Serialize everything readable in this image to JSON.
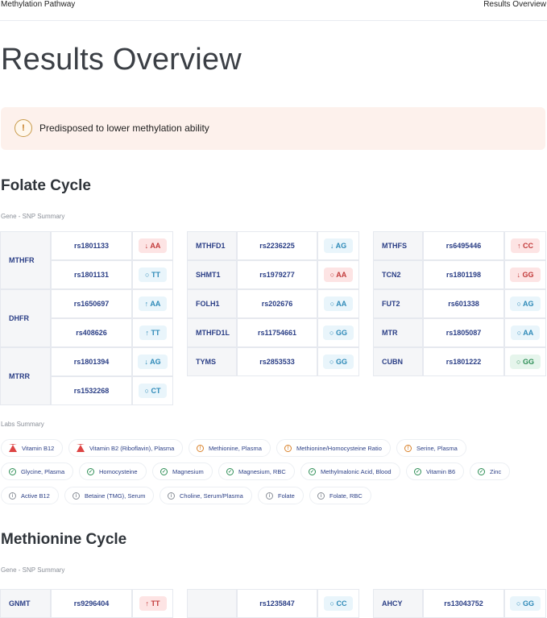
{
  "header": {
    "left": "Methylation Pathway",
    "right": "Results Overview"
  },
  "page_title": "Results Overview",
  "alert": {
    "icon": "exclamation-icon",
    "text": "Predisposed to lower methylation ability"
  },
  "folate": {
    "title": "Folate Cycle",
    "snp_label": "Gene - SNP Summary",
    "col1": {
      "rows": [
        {
          "gene": "MTHFR",
          "rs": "rs1801133",
          "gt": "↓ AA",
          "kind": "red"
        },
        {
          "gene": "",
          "rs": "rs1801131",
          "gt": "○ TT",
          "kind": "blue"
        },
        {
          "gene": "DHFR",
          "rs": "rs1650697",
          "gt": "↑ AA",
          "kind": "blue"
        },
        {
          "gene": "",
          "rs": "rs408626",
          "gt": "↑ TT",
          "kind": "blue"
        },
        {
          "gene": "MTRR",
          "rs": "rs1801394",
          "gt": "↓ AG",
          "kind": "blue"
        },
        {
          "gene": "",
          "rs": "rs1532268",
          "gt": "○ CT",
          "kind": "blue"
        }
      ]
    },
    "col2": {
      "rows": [
        {
          "gene": "MTHFD1",
          "rs": "rs2236225",
          "gt": "↓ AG",
          "kind": "blue"
        },
        {
          "gene": "SHMT1",
          "rs": "rs1979277",
          "gt": "○ AA",
          "kind": "red"
        },
        {
          "gene": "FOLH1",
          "rs": "rs202676",
          "gt": "○ AA",
          "kind": "blue"
        },
        {
          "gene": "MTHFD1L",
          "rs": "rs11754661",
          "gt": "○ GG",
          "kind": "blue"
        },
        {
          "gene": "TYMS",
          "rs": "rs2853533",
          "gt": "○ GG",
          "kind": "blue"
        }
      ]
    },
    "col3": {
      "rows": [
        {
          "gene": "MTHFS",
          "rs": "rs6495446",
          "gt": "↑ CC",
          "kind": "red"
        },
        {
          "gene": "TCN2",
          "rs": "rs1801198",
          "gt": "↓ GG",
          "kind": "red"
        },
        {
          "gene": "FUT2",
          "rs": "rs601338",
          "gt": "○ AG",
          "kind": "blue"
        },
        {
          "gene": "MTR",
          "rs": "rs1805087",
          "gt": "○ AA",
          "kind": "blue"
        },
        {
          "gene": "CUBN",
          "rs": "rs1801222",
          "gt": "○ GG",
          "kind": "green"
        }
      ]
    },
    "labs_label": "Labs Summary",
    "labs": [
      [
        {
          "label": "Vitamin B12",
          "icon": "warning-icon",
          "kind": "warn"
        },
        {
          "label": "Vitamin B2 (Riboflavin), Plasma",
          "icon": "warning-icon",
          "kind": "warn"
        },
        {
          "label": "Methionine, Plasma",
          "icon": "info-icon",
          "kind": "orange"
        },
        {
          "label": "Methionine/Homocysteine Ratio",
          "icon": "info-icon",
          "kind": "orange"
        },
        {
          "label": "Serine, Plasma",
          "icon": "info-icon",
          "kind": "orange"
        }
      ],
      [
        {
          "label": "Glycine, Plasma",
          "icon": "check-icon",
          "kind": "green"
        },
        {
          "label": "Homocysteine",
          "icon": "check-icon",
          "kind": "green"
        },
        {
          "label": "Magnesium",
          "icon": "check-icon",
          "kind": "green"
        },
        {
          "label": "Magnesium, RBC",
          "icon": "check-icon",
          "kind": "green"
        },
        {
          "label": "Methylmalonic Acid, Blood",
          "icon": "check-icon",
          "kind": "green"
        },
        {
          "label": "Vitamin B6",
          "icon": "check-icon",
          "kind": "green"
        },
        {
          "label": "Zinc",
          "icon": "check-icon",
          "kind": "green"
        }
      ],
      [
        {
          "label": "Active B12",
          "icon": "info-icon",
          "kind": "grey"
        },
        {
          "label": "Betaine (TMG), Serum",
          "icon": "info-icon",
          "kind": "grey"
        },
        {
          "label": "Choline, Serum/Plasma",
          "icon": "info-icon",
          "kind": "grey"
        },
        {
          "label": "Folate",
          "icon": "info-icon",
          "kind": "grey"
        },
        {
          "label": "Folate, RBC",
          "icon": "info-icon",
          "kind": "grey"
        }
      ]
    ]
  },
  "methionine": {
    "title": "Methionine Cycle",
    "snp_label": "Gene - SNP Summary",
    "partial_rows": [
      {
        "gene": "GNMT",
        "rs": "rs9296404",
        "gt": "↑ TT",
        "kind": "red"
      },
      {
        "gene": "",
        "rs": "rs1235847",
        "gt": "○ CC",
        "kind": "blue"
      },
      {
        "gene": "AHCY",
        "rs": "rs13043752",
        "gt": "○ GG",
        "kind": "blue"
      }
    ]
  },
  "colors": {
    "accent_text": "#2b3f86",
    "alert_bg": "#fdf1ec",
    "red": "#c23a3a",
    "blue": "#2f8ab8",
    "green": "#2f8f57"
  }
}
